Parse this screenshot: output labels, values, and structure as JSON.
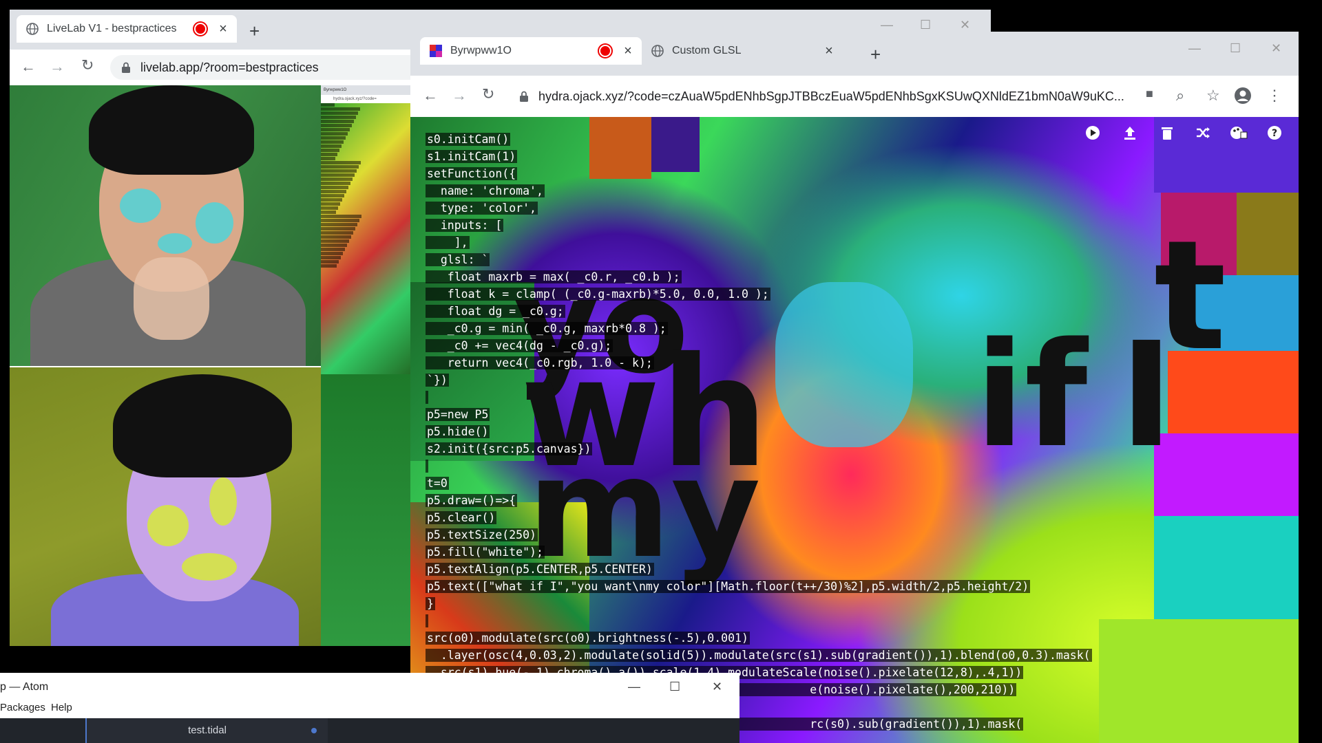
{
  "livelab_window": {
    "tab_title": "LiveLab V1 - bestpractices",
    "url": "livelab.app/?room=bestpractices",
    "new_tab": "+",
    "mini_preview": {
      "tab_title": "Byrwpww1O",
      "url": "hydra.ojack.xyz/?code="
    }
  },
  "hydra_window": {
    "tabs": [
      {
        "title": "Byrwpww1O",
        "recording": true
      },
      {
        "title": "Custom GLSL",
        "recording": false
      }
    ],
    "new_tab": "+",
    "url": "hydra.ojack.xyz/?code=czAuaW5pdENhbSgpJTBBczEuaW5pdENhbSgxKSUwQXNldEZ1bmN0aW9uKC...",
    "overlay_text": {
      "yo": "yo",
      "wh": "wh",
      "if": "if",
      "i": "I",
      "t": "t",
      "my": "my"
    },
    "toolbar_icons": [
      "play-icon",
      "upload-icon",
      "trash-icon",
      "shuffle-icon",
      "palette-icon",
      "help-icon"
    ],
    "code_lines": [
      "s0.initCam()",
      "s1.initCam(1)",
      "setFunction({",
      "  name: 'chroma',",
      "  type: 'color',",
      "  inputs: [",
      "    ],",
      "  glsl: `",
      "   float maxrb = max( _c0.r, _c0.b );",
      "   float k = clamp( (_c0.g-maxrb)*5.0, 0.0, 1.0 );",
      "   float dg = _c0.g;",
      "   _c0.g = min( _c0.g, maxrb*0.8 );",
      "   _c0 += vec4(dg - _c0.g);",
      "   return vec4(_c0.rgb, 1.0 - k);",
      "`})",
      "",
      "p5=new P5",
      "p5.hide()",
      "s2.init({src:p5.canvas})",
      "",
      "t=0",
      "p5.draw=()=>{",
      "p5.clear()",
      "p5.textSize(250)",
      "p5.fill(\"white\");",
      "p5.textAlign(p5.CENTER,p5.CENTER)",
      "p5.text([\"what if I\",\"you want\\nmy color\"][Math.floor(t++/30)%2],p5.width/2,p5.height/2)",
      "}",
      "",
      "src(o0).modulate(src(o0).brightness(-.5),0.001)",
      "  .layer(osc(4,0.03,2).modulate(solid(5)).modulate(src(s1).sub(gradient()),1).blend(o0,0.3).mask(",
      "  src(s1).hue(-.1).chroma().a()).scale(1.4).modulateScale(noise().pixelate(12,8),.4,1))",
      "                                                        e(noise().pixelate(),200,210))",
      "",
      "                                                        rc(s0).sub(gradient()),1).mask("
    ]
  },
  "atom_window": {
    "title": "p — Atom",
    "menu": [
      "Packages",
      "Help"
    ],
    "tab": "test.tidal"
  },
  "colors": {
    "chrome_tabstrip": "#dee1e6",
    "record_red": "#e00000",
    "atom_dark": "#21252b",
    "atom_accent": "#4d78cc"
  }
}
